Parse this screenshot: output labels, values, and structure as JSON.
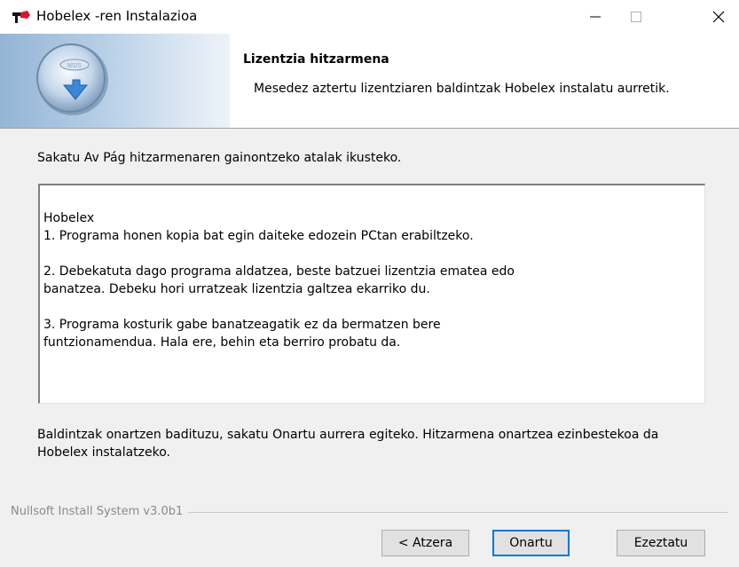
{
  "window": {
    "title": "Hobelex -ren Instalazioa",
    "controls": [
      "minimize",
      "maximize",
      "close"
    ]
  },
  "header": {
    "title": "Lizentzia hitzarmena",
    "subtitle": "Mesedez aztertu lizentziaren baldintzak Hobelex instalatu aurretik."
  },
  "instruction": "Sakatu Av Pág hitzarmenaren gainontzeko atalak ikusteko.",
  "license": {
    "lines": [
      "Hobelex",
      "1. Programa honen kopia bat egin daiteke edozein PCtan erabiltzeko.",
      "",
      "2. Debekatuta dago programa aldatzea, beste batzuei lizentzia ematea edo",
      "banatzea. Debeku hori urratzeak lizentzia galtzea ekarriko du.",
      "",
      "3. Programa kosturik gabe banatzeagatik ez da bermatzen bere",
      "funtzionamendua. Hala ere, behin eta berriro probatu da."
    ]
  },
  "accept_note": "Baldintzak onartzen badituzu, sakatu Onartu aurrera egiteko. Hitzarmena onartzea ezinbestekoa da Hobelex instalatzeko.",
  "branding": "Nullsoft Install System v3.0b1",
  "buttons": {
    "back": "< Atzera",
    "accept": "Onartu",
    "cancel": "Ezeztatu"
  },
  "colors": {
    "focus_border": "#0078d7",
    "dialog_bg": "#f0f0f0",
    "header_bg": "#ffffff"
  }
}
